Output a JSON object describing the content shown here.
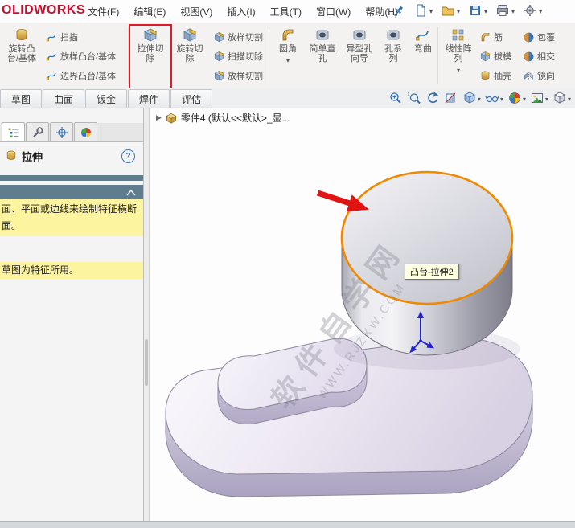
{
  "menu_bar": {
    "logo": "OLIDWORKS",
    "items": [
      "文件(F)",
      "编辑(E)",
      "视图(V)",
      "插入(I)",
      "工具(T)",
      "窗口(W)",
      "帮助(H)"
    ]
  },
  "icons": {
    "quick": [
      "new-document-icon",
      "open-icon",
      "save-icon",
      "print-icon",
      "options-icon"
    ],
    "view": [
      "zoom-fit-icon",
      "zoom-area-icon",
      "previous-view-icon",
      "section-view-icon",
      "display-style-icon",
      "hide-items-icon",
      "appearance-icon",
      "scene-icon",
      "view-orientation-icon"
    ],
    "panel_tabs": [
      "featuremanager-icon",
      "propertymanager-icon",
      "configurationmanager-icon",
      "displaymanager-icon"
    ]
  },
  "ribbon": {
    "highlight_color": "#e01b24",
    "buttons": {
      "revolve_boss": "旋转凸台/基体",
      "sweep": "扫描",
      "loft_boss": "放样凸台/基体",
      "boundary_boss": "边界凸台/基体",
      "extruded_cut": "拉伸切除",
      "revolved_cut": "旋转切除",
      "lofted_cut": "放样切割",
      "swept_cut": "扫描切除",
      "lofted_cut2": "放样切割",
      "fillet": "圆角",
      "simple_hole": "简单直孔",
      "hole_wizard": "异型孔向导",
      "hole_series": "孔系列",
      "flex": "弯曲",
      "linear_pattern": "线性阵列",
      "rib": "筋",
      "draft": "拔模",
      "shell": "抽壳",
      "wrap": "包覆",
      "intersect": "相交",
      "mirror": "镜向"
    }
  },
  "tab_bar": {
    "tabs": [
      "草图",
      "曲面",
      "钣金",
      "焊件",
      "评估"
    ]
  },
  "feature_tree": {
    "expander": "▶",
    "root": "零件4 (默认<<默认>_显..."
  },
  "property_manager": {
    "title": "拉伸",
    "help": "?",
    "message1": "面、平面或边线来绘制特征横断面。",
    "message2": "草图为特征所用。",
    "highlight_color": "#fdf49f"
  },
  "viewport": {
    "tooltip": "凸台-拉伸2",
    "watermark_line1": "软件自学网",
    "watermark_line2": "WWW.RJZXW.COM",
    "selection_color": "#ef8a00",
    "arrow_color": "#e11414"
  }
}
